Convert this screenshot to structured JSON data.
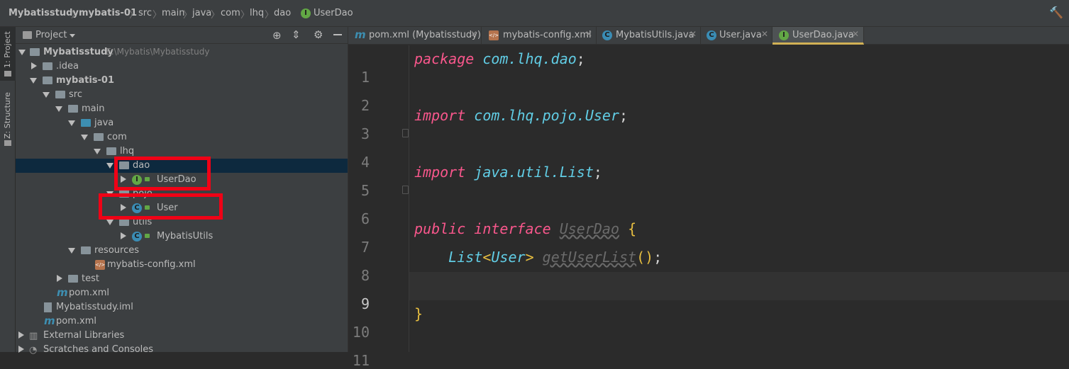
{
  "breadcrumb": [
    "Mybatisstudy",
    "mybatis-01",
    "src",
    "main",
    "java",
    "com",
    "lhq",
    "dao",
    "UserDao"
  ],
  "side_tabs": [
    "1: Project",
    "Z: Structure"
  ],
  "project_panel": {
    "title": "Project",
    "tree": [
      {
        "label": "Mybatisstudy",
        "path": "E:\\Mybatis\\Mybatisstudy"
      },
      {
        "label": ".idea"
      },
      {
        "label": "mybatis-01"
      },
      {
        "label": "src"
      },
      {
        "label": "main"
      },
      {
        "label": "java"
      },
      {
        "label": "com"
      },
      {
        "label": "lhq"
      },
      {
        "label": "dao"
      },
      {
        "label": "UserDao",
        "icon": "I"
      },
      {
        "label": "pojo"
      },
      {
        "label": "User",
        "icon": "C"
      },
      {
        "label": "utils"
      },
      {
        "label": "MybatisUtils",
        "icon": "C"
      },
      {
        "label": "resources"
      },
      {
        "label": "mybatis-config.xml"
      },
      {
        "label": "test"
      },
      {
        "label": "pom.xml"
      },
      {
        "label": "Mybatisstudy.iml"
      },
      {
        "label": "pom.xml"
      },
      {
        "label": "External Libraries"
      },
      {
        "label": "Scratches and Consoles"
      }
    ]
  },
  "tabs": [
    {
      "label": "pom.xml (Mybatisstudy)",
      "icon": "m"
    },
    {
      "label": "mybatis-config.xml",
      "icon": "xml"
    },
    {
      "label": "MybatisUtils.java",
      "icon": "C"
    },
    {
      "label": "User.java",
      "icon": "C"
    },
    {
      "label": "UserDao.java",
      "icon": "I",
      "active": true
    }
  ],
  "editor": {
    "line_numbers": [
      "1",
      "2",
      "3",
      "4",
      "5",
      "6",
      "7",
      "8",
      "9",
      "10",
      "11"
    ],
    "current_line": "9",
    "code": {
      "l1": {
        "kw": "package",
        "pk": "com.lhq.dao",
        "semi": ";"
      },
      "l3": {
        "kw": "import",
        "pk": "com.lhq.pojo.User",
        "semi": ";"
      },
      "l5": {
        "kw": "import",
        "pk": "java.util.List",
        "semi": ";"
      },
      "l7": {
        "kw1": "public",
        "kw2": "interface",
        "name": "UserDao",
        "brace": "{"
      },
      "l8": {
        "type1": "List",
        "lt": "<",
        "type2": "User",
        "gt": ">",
        "method": "getUserList",
        "paren": "()",
        "semi": ";"
      },
      "l10": {
        "brace": "}"
      }
    }
  },
  "colors": {
    "keyword": "#f9578c",
    "package": "#61cde5",
    "highlight_box": "#f00216",
    "selection": "#0d293e"
  }
}
